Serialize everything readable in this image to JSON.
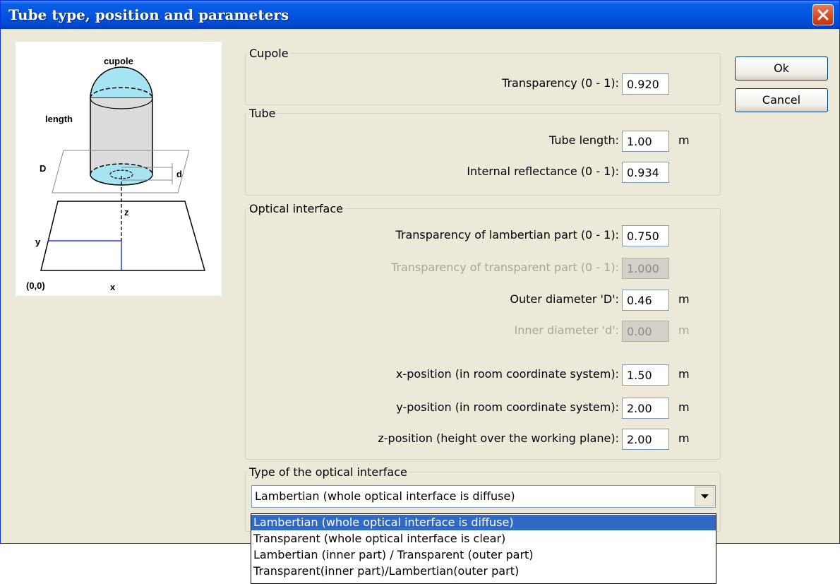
{
  "window": {
    "title": "Tube type, position and parameters"
  },
  "colors": {
    "titlebar": "#0155e0",
    "dialog_bg": "#ece9d8",
    "selection": "#316ac5",
    "close": "#d8481d"
  },
  "illustration": {
    "labels": {
      "cupole": "cupole",
      "length": "length",
      "D": "D",
      "d": "d",
      "z": "z",
      "y": "y",
      "x": "x",
      "origin": "(0,0)"
    }
  },
  "cupole": {
    "legend": "Cupole",
    "transparency_label": "Transparency (0 - 1):",
    "transparency_value": "0.920"
  },
  "tube": {
    "legend": "Tube",
    "length_label": "Tube length:",
    "length_value": "1.00",
    "length_unit": "m",
    "reflectance_label": "Internal reflectance (0 - 1):",
    "reflectance_value": "0.934"
  },
  "optical": {
    "legend": "Optical interface",
    "lamb_label": "Transparency of lambertian part (0 - 1):",
    "lamb_value": "0.750",
    "trans_label": "Transparency of transparent part (0 - 1):",
    "trans_value": "1.000",
    "outer_label": "Outer diameter 'D':",
    "outer_value": "0.46",
    "outer_unit": "m",
    "inner_label": "Inner diameter 'd':",
    "inner_value": "0.00",
    "inner_unit": "m",
    "x_label": "x-position (in room coordinate system):",
    "x_value": "1.50",
    "x_unit": "m",
    "y_label": "y-position (in room coordinate system):",
    "y_value": "2.00",
    "y_unit": "m",
    "z_label": "z-position (height over the working plane):",
    "z_value": "2.00",
    "z_unit": "m"
  },
  "type": {
    "legend": "Type of the optical interface",
    "selected": "Lambertian (whole optical interface is diffuse)",
    "options": [
      "Lambertian (whole optical interface is diffuse)",
      "Transparent (whole optical interface is clear)",
      "Lambertian (inner part) / Transparent (outer part)",
      "Transparent(inner part)/Lambertian(outer part)"
    ]
  },
  "buttons": {
    "ok": "Ok",
    "cancel": "Cancel"
  }
}
